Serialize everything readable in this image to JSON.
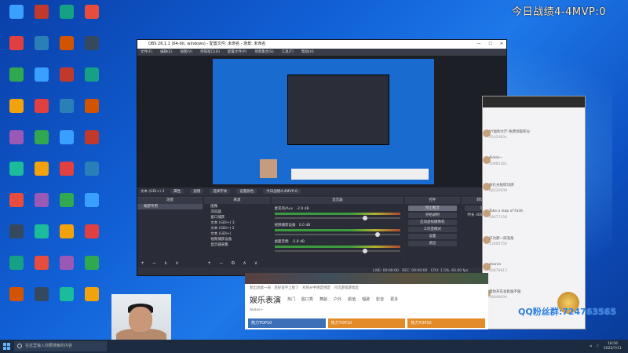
{
  "overlay": {
    "score_text": "今日战绩4-4MVP:0"
  },
  "obs": {
    "title": "OBS 26.1.1 (64-bit, windows) - 配置文件: 未命名 - 场景: 未命名",
    "menu": [
      "文件(F)",
      "编辑(E)",
      "视图(V)",
      "停靠窗口(D)",
      "配置文件(P)",
      "场景集合(S)",
      "工具(T)",
      "帮助(H)"
    ],
    "source_label": "文本 (GDI+) 3",
    "controls_bar": [
      "属性",
      "滤镜",
      "选择字体",
      "设置颜色",
      "今日战绩4-4MVP:0"
    ],
    "docks": {
      "scenes": {
        "header": "场景",
        "items": [
          "端游专用"
        ]
      },
      "sources": {
        "header": "来源",
        "items": [
          "图像",
          "浏览器",
          "窗口捕获",
          "文本 (GDI+) 3",
          "文本 (GDI+) 2",
          "文本 (GDI+)",
          "视频捕获设备",
          "显示器采集"
        ]
      },
      "mixer": {
        "header": "混音器",
        "tracks": [
          {
            "name": "麦克风/Aux",
            "db": "-2.9 dB"
          },
          {
            "name": "视频捕获设备",
            "db": "0.0 dB"
          },
          {
            "name": "桌面音频",
            "db": "-5.8 dB"
          }
        ]
      },
      "controls": {
        "header": "控件",
        "buttons": [
          "停止推流",
          "开始录制",
          "启动虚拟摄像机",
          "工作室模式",
          "设置",
          "退出"
        ]
      },
      "transitions": {
        "header": "转场特效",
        "mode": "淡出",
        "duration_label": "时长",
        "duration": "300 ms"
      }
    },
    "status": {
      "live": "LIVE: 00:00:00",
      "rec": "REC: 00:00:00",
      "cpu": "CPU: 1.5%, 60.00 fps"
    }
  },
  "chat": {
    "messages": [
      {
        "name": "YY福利大厅-免费领取积分",
        "id": "2545460x"
      },
      {
        "name": "Aiolos~",
        "id": "50985281"
      },
      {
        "name": "深孔光般练功牌",
        "id": "68320008"
      },
      {
        "name": "Take a leap of Faith",
        "id": "58677158"
      },
      {
        "name": "只为那一抹温柔",
        "id": "13600759"
      },
      {
        "name": "sharon",
        "id": "60870813"
      },
      {
        "name": "嗯你开车会影服不服",
        "id": "58848009"
      }
    ]
  },
  "video": {
    "captions": [
      "新出池第一局",
      "还好说不上脸了",
      "对的分手绑定绑定",
      "只玩游戏游戏玩"
    ],
    "section_title": "娱乐表演",
    "categories": [
      "热门",
      "脱口秀",
      "舞蹈",
      "户外",
      "颜值",
      "唱歌",
      "影音",
      "更多"
    ],
    "search_placeholder": "Aiolos~",
    "tiles": [
      "热力TOP10",
      "热力TOP10",
      "热力TOP10"
    ]
  },
  "qq": {
    "text": "QQ粉丝群:724763565"
  },
  "taskbar": {
    "search_placeholder": "在这里输入你要搜索的内容",
    "time": "18:56",
    "date": "2022/7/11"
  },
  "colors": {
    "desktop": "#1160d6",
    "obs_bg": "#2b2e38",
    "score": "#ffe7c2",
    "qq": "#2a7de1",
    "taskbar": "#1c2b3f"
  }
}
